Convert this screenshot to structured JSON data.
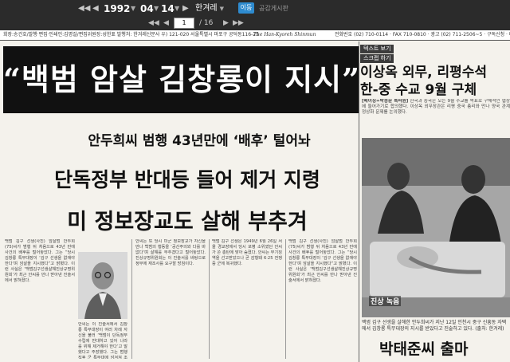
{
  "toolbar": {
    "first": "◀◀",
    "prev": "◀",
    "year": "1992",
    "month": "04",
    "day": "14",
    "next": "▶",
    "last": "▶▶",
    "paper": "한겨레",
    "move_label": "이동",
    "notice": "공감게시판",
    "page_current": "1",
    "page_total": "/ 16",
    "page_first": "◀◀",
    "page_prev": "◀",
    "page_next": "▶",
    "page_last": "▶▶"
  },
  "masthead": {
    "left": "회장:송건호/발행·편집·인쇄인:김명걸/편집위원장:성한표 발행처: 한겨레신문사 우) 121-020 서울특별시 마포구 공덕동116-25",
    "center": "The Han-Kyoreh Shinmun",
    "right": "전화번호 (02) 710-0114 · FAX 710-0810 · 광고 (02) 711-2506~5 · 구독신청 · 배달확인 (02)"
  },
  "article": {
    "headline": "“백범 암살 김창룡이 지시”",
    "kicker": "안두희씨 범행 43년만에 ‘배후’ 털어놔",
    "deck1": "단독정부 반대등 들어 제거 지령",
    "deck2": "미 정보장교도 살해 부추겨",
    "body_col1": "백범 김구 선생(사진) 암살범 안두희(75)씨가 범행 뒤 처음으로 43년 만에 사건의 배후를 털어놓았다. 그는 “당시 김창룡 특무대장이 ‘김구 선생을 없애야 한다’며 암살을 지시했다”고 밝혔다. 이런 사실은 ‘백범김구선생살해진상규명위원회’가 최근 안씨를 만나 받아낸 진술서에서 밝혀졌다.",
    "body_col2": "안씨는 이 진술서에서 김창룡 특무대장이 여러 차례 자신을 불러 ‘백범이 단독정부 수립에 반대하고 있어 나라를 위해 제거해야 한다’고 말했다고 주장했다. 그는 범행 직후 군 특무대에 넘겨져 조사를 받았으며",
    "body_col3": "안씨는 또 당시 미군 정보장교가 자신을 만나 백범의 행동을 ‘공산주의와 다를 바 없다’며 살해를 부추겼다고 털어놓았다. 진상규명위원회는 이 진술서를 바탕으로 정부에 재조사를 요구할 방침이다.",
    "body_col4": "백범 김구 선생은 1949년 6월 26일 서울 경교장에서 당시 포병 소위였던 안씨가 쏜 총탄에 맞아 숨졌다. 안씨는 무기징역을 선고받았으나 곧 감형돼 6·25 전쟁 중 군에 복귀했다."
  },
  "right": {
    "text_view_label": "텍스트 보기",
    "scrap_label": "스크랩 하기",
    "head1": "이상옥 외무, 리평수석",
    "head2": "한-중 수교 9월 구체",
    "byline": "[베이징=박종문 특파원]",
    "body": "한국과 중국은 오는 9월 수교를 목표로 구체적인 협상에 들어가기로 합의했다. 이상옥 외무장관은 리평 중국 총리와 만나 양국 관계 정상화 문제를 논의했다.",
    "photo_tag": "진상 녹음",
    "caption": "백범 김구 선생을 살해한 안두희씨가 지난 12일 인천시 중구 신흥동 자택에서 김창룡 특무대장의 지시를 받았다고 진술하고 있다. (출처: 한겨레)",
    "bottom_head": "박태준씨 출마"
  }
}
